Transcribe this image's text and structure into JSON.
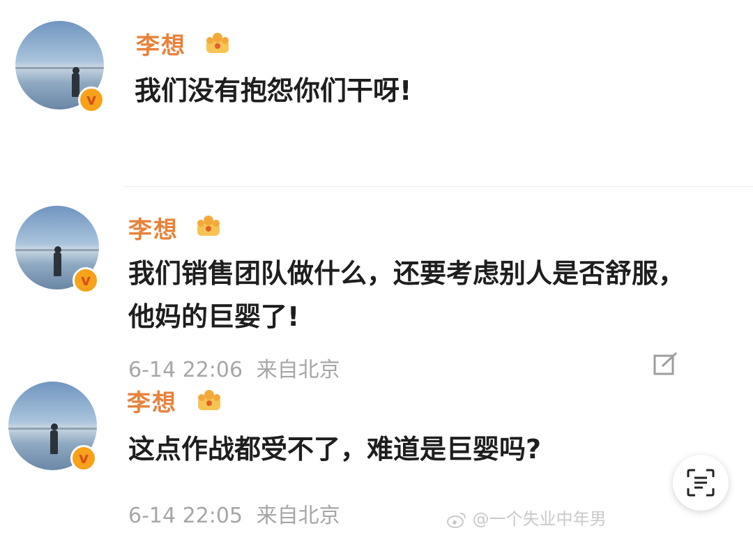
{
  "posts": [
    {
      "username": "李想",
      "text_lines": [
        "我们没有抱怨你们干呀!"
      ],
      "timestamp": "",
      "location": ""
    },
    {
      "username": "李想",
      "text_lines": [
        "我们销售团队做什么，还要考虑别人是否舒服，",
        "他妈的巨婴了!"
      ],
      "timestamp": "6-14 22:06",
      "location": "来自北京"
    },
    {
      "username": "李想",
      "text_lines": [
        "这点作战都受不了，难道是巨婴吗?"
      ],
      "timestamp": "6-14 22:05",
      "location": "来自北京"
    }
  ],
  "badge_letter": "v",
  "watermark": "@一个失业中年男",
  "colors": {
    "username": "#e8823a",
    "verified_badge": "#f7a21a",
    "meta_text": "#a6a6a6"
  },
  "icons": [
    "crown-icon",
    "verified-badge-icon",
    "share-icon",
    "scan-text-icon",
    "weibo-logo-icon"
  ]
}
